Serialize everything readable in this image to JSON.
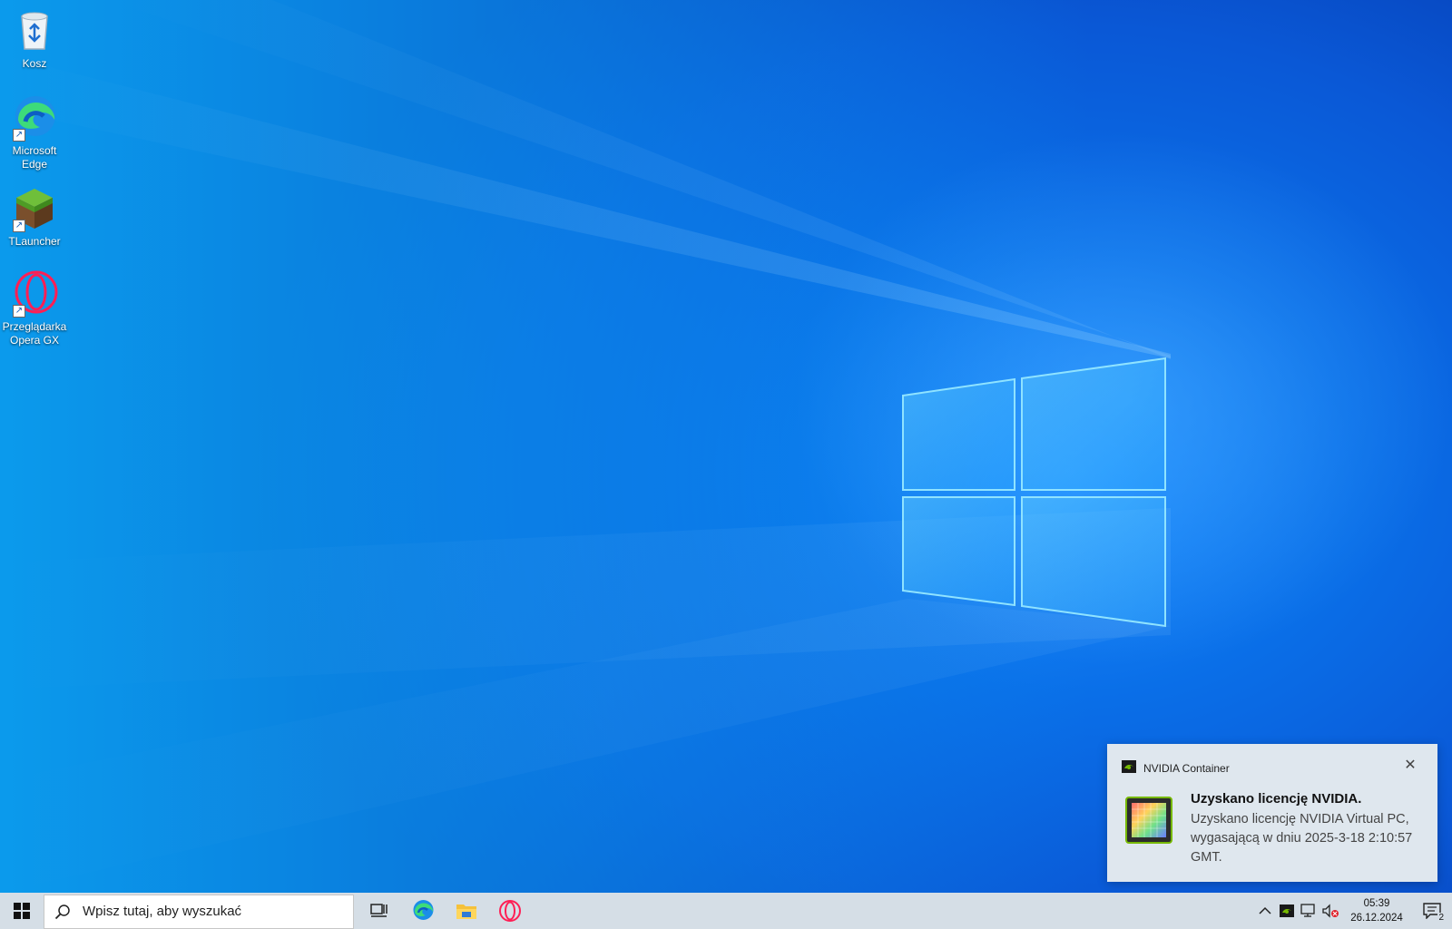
{
  "desktop": {
    "icons": [
      {
        "label": "Kosz",
        "icon": "recycle-bin-icon"
      },
      {
        "label": "Microsoft\nEdge",
        "icon": "edge-icon"
      },
      {
        "label": "TLauncher",
        "icon": "grass-block-icon"
      },
      {
        "label": "Przeglądarka\nOpera GX",
        "icon": "opera-gx-icon"
      }
    ]
  },
  "notification": {
    "app_name": "NVIDIA Container",
    "title": "Uzyskano licencję NVIDIA.",
    "body": "Uzyskano licencję NVIDIA Virtual PC, wygasającą w dniu 2025-3-18 2:10:57 GMT.",
    "close_icon": "close-icon",
    "app_icon": "nvidia-icon",
    "image_icon": "gpu-chip-icon"
  },
  "taskbar": {
    "search_placeholder": "Wpisz tutaj, aby wyszukać",
    "pinned": [
      "task-view-icon",
      "edge-icon",
      "file-explorer-icon",
      "opera-gx-icon"
    ],
    "tray": {
      "icons": [
        "chevron-up-icon",
        "nvidia-icon",
        "network-icon",
        "volume-muted-icon"
      ],
      "time": "05:39",
      "date": "26.12.2024",
      "notification_count": "2"
    }
  },
  "colors": {
    "wallpaper_light": "#0aa7f2",
    "wallpaper_dark": "#0641b8",
    "taskbar": "#d5dee6",
    "toast": "#dfe7ee",
    "nvidia_green": "#76b900"
  }
}
